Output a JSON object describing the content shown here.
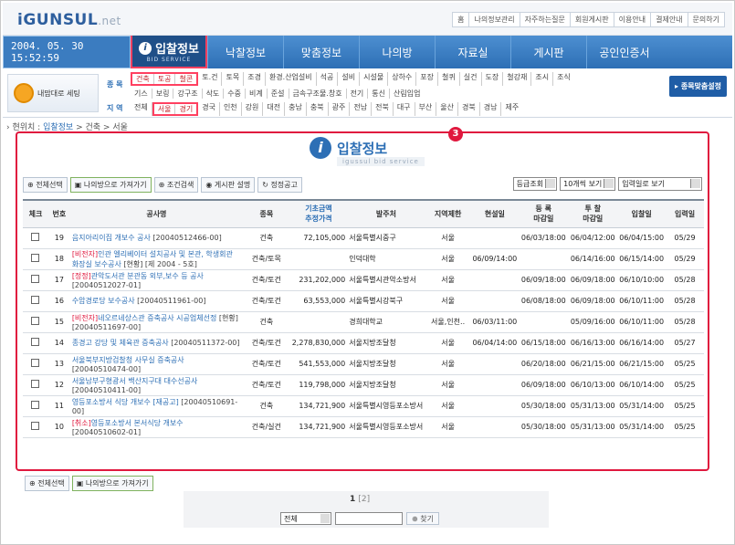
{
  "header": {
    "logo": "iGUNSUL",
    "logo_suffix": ".net",
    "links": [
      "홈",
      "나의정보관리",
      "자주하는질문",
      "회원게시판",
      "이용안내",
      "결제안내",
      "문의하기"
    ]
  },
  "nav": {
    "datetime": "2004. 05. 30 15:52:59",
    "active_tab": "입찰정보",
    "active_sub": "BID SERVICE",
    "tabs": [
      "낙찰정보",
      "맞춤정보",
      "나의방",
      "자료실",
      "게시판",
      "공인인증서"
    ]
  },
  "filter": {
    "my_setting": "내맘대로 세팅",
    "label_type": "종 목",
    "label_region": "지 역",
    "type_row1_hl": [
      "건축",
      "토공",
      "철콘"
    ],
    "type_row1": [
      "토.건",
      "토목",
      "조경",
      "환경.산업설비",
      "석공",
      "설비",
      "시설물",
      "상하수",
      "포장",
      "철퀴",
      "실건",
      "도장",
      "철강재",
      "조시",
      "조식"
    ],
    "type_row2": [
      "기스",
      "보링",
      "강구조",
      "삭도",
      "수중",
      "비계",
      "준설",
      "금속구조물.창호",
      "전기",
      "통신",
      "산림입업"
    ],
    "region_all": "전체",
    "region_hl": [
      "서울",
      "경기"
    ],
    "regions": [
      "경국",
      "인천",
      "강원",
      "대전",
      "충남",
      "충북",
      "광주",
      "전남",
      "전북",
      "대구",
      "부산",
      "울산",
      "경북",
      "경남",
      "제주"
    ],
    "fit_button": "종목맞춤설정"
  },
  "breadcrumb": {
    "prefix": "현위치 :",
    "current": "입찰정보",
    "rest": "> 건축 > 서울"
  },
  "panel": {
    "marker": "3",
    "title": "입찰정보",
    "subtitle": "igussul bid service",
    "buttons": {
      "select_all": "전체선택",
      "to_myroom": "나의방으로 가져가기",
      "condition": "조건검색",
      "board": "게시판 설명",
      "update": "정정공고"
    },
    "selects": {
      "grade": "등급조회",
      "perpage": "10개씩 보기",
      "order": "입력일로 보기"
    }
  },
  "table": {
    "headers": {
      "check": "체크",
      "no": "번호",
      "name": "공사명",
      "type": "종목",
      "price": "기초금액",
      "price2": "추정가격",
      "client": "발주처",
      "region": "지역제한",
      "site": "현설일",
      "reg": "등 록",
      "reg2": "마감일",
      "bid": "투 찰",
      "bid2": "마감일",
      "open": "입찰일",
      "input": "입력일"
    },
    "rows": [
      {
        "no": "19",
        "tag": "",
        "name": "음지아리이집 개보수 공사",
        "code": "[20040512466-00]",
        "type": "건축",
        "price": "72,105,000",
        "client": "서울특별시중구",
        "region": "서울",
        "site": "",
        "reg": "06/03/18:00",
        "bid": "06/04/12:00",
        "open": "06/04/15:00",
        "input": "05/29"
      },
      {
        "no": "18",
        "tag": "[비전자]",
        "name": "인관 엘리베이터 설치공사 및 본관, 학생회관 화장실 보수공사",
        "code": "[현황] [제 2004 - 5호]",
        "type": "건축/토목",
        "price": "",
        "client": "인덕대학",
        "region": "서울",
        "site": "06/09/14:00",
        "reg": "",
        "bid": "06/14/16:00",
        "open": "06/15/14:00",
        "input": "05/29"
      },
      {
        "no": "17",
        "tag": "[정정]",
        "name": "관악도서관 분관동 외부,보수 등 공사",
        "code": "[20040512027-01]",
        "type": "건축/토건",
        "price": "231,202,000",
        "client": "서울특별시관악소방서",
        "region": "서울",
        "site": "",
        "reg": "06/09/18:00",
        "bid": "06/09/18:00",
        "open": "06/10/10:00",
        "input": "05/28"
      },
      {
        "no": "16",
        "tag": "",
        "name": "수암경로당 보수공사",
        "code": "[20040511961-00]",
        "type": "건축/토건",
        "price": "63,553,000",
        "client": "서울특별시강북구",
        "region": "서울",
        "site": "",
        "reg": "06/08/18:00",
        "bid": "06/09/18:00",
        "open": "06/10/11:00",
        "input": "05/28"
      },
      {
        "no": "15",
        "tag": "[비전자]",
        "name": "네오르네상스관 증축공사 시공업체선정",
        "code": "[현황] [20040511697-00]",
        "type": "건축",
        "price": "",
        "client": "경희대학교",
        "region": "서울,인천..",
        "site": "06/03/11:00",
        "reg": "",
        "bid": "05/09/16:00",
        "open": "06/10/11:00",
        "input": "05/28"
      },
      {
        "no": "14",
        "tag": "",
        "name": "종경고 강당 및 체육관 증축공사",
        "code": "[20040511372-00]",
        "type": "건축/토건",
        "price": "2,278,830,000",
        "client": "서울지방조달청",
        "region": "서울",
        "site": "06/04/14:00",
        "reg": "06/15/18:00",
        "bid": "06/16/13:00",
        "open": "06/16/14:00",
        "input": "05/27"
      },
      {
        "no": "13",
        "tag": "",
        "name": "서울북부지방검찰청 사무실 증축공사",
        "code": "[20040510474-00]",
        "type": "건축/토건",
        "price": "541,553,000",
        "client": "서울지방조달청",
        "region": "서울",
        "site": "",
        "reg": "06/20/18:00",
        "bid": "06/21/15:00",
        "open": "06/21/15:00",
        "input": "05/25"
      },
      {
        "no": "12",
        "tag": "",
        "name": "서울남부구형광서 백산지구대 대수선공사",
        "code": "[20040510411-00]",
        "type": "건축/토건",
        "price": "119,798,000",
        "client": "서울지방조달청",
        "region": "서울",
        "site": "",
        "reg": "06/09/18:00",
        "bid": "06/10/13:00",
        "open": "06/10/14:00",
        "input": "05/25"
      },
      {
        "no": "11",
        "tag": "",
        "name": "영등포소방서 식당 개보수 [재공고]",
        "code": "[20040510691-00]",
        "type": "건축",
        "price": "134,721,900",
        "client": "서울특별시영등포소방서",
        "region": "서울",
        "site": "",
        "reg": "05/30/18:00",
        "bid": "05/31/13:00",
        "open": "05/31/14:00",
        "input": "05/25"
      },
      {
        "no": "10",
        "tag": "[취소]",
        "name": "영등포소방서 본서식당 개보수",
        "code": "[20040510602-01]",
        "type": "건축/실건",
        "price": "134,721,900",
        "client": "서울특별시영등포소방서",
        "region": "서울",
        "site": "",
        "reg": "05/30/18:00",
        "bid": "05/31/13:00",
        "open": "05/31/14:00",
        "input": "05/25"
      }
    ]
  },
  "footer": {
    "select_all": "전체선택",
    "to_myroom": "나의방으로 가져가기",
    "page_current": "1",
    "page_other": "[2]",
    "search_scope": "전체",
    "search_button": "찾기"
  }
}
